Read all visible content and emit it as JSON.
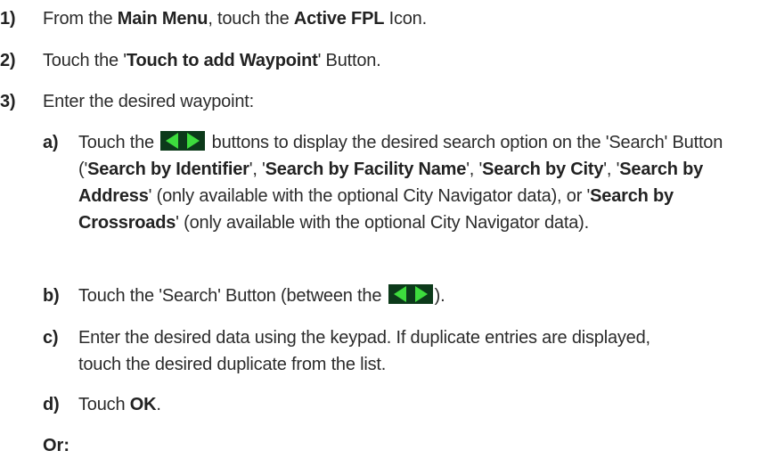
{
  "steps": [
    {
      "num": "1)",
      "parts": [
        {
          "t": "From the "
        },
        {
          "t": "Main Menu",
          "b": true
        },
        {
          "t": ", touch the "
        },
        {
          "t": "Active FPL",
          "b": true
        },
        {
          "t": " Icon."
        }
      ]
    },
    {
      "num": "2)",
      "parts": [
        {
          "t": "Touch the '"
        },
        {
          "t": "Touch to add Waypoint",
          "b": true
        },
        {
          "t": "' Button."
        }
      ]
    },
    {
      "num": "3)",
      "parts": [
        {
          "t": "Enter the desired waypoint:"
        }
      ]
    }
  ],
  "substeps": [
    {
      "num": "a)",
      "parts": [
        {
          "t": "Touch the "
        },
        {
          "icon": "arrow-buttons-icon"
        },
        {
          "t": " buttons to display the desired search option on the 'Search' Button ('"
        },
        {
          "t": "Search by Identifier",
          "b": true
        },
        {
          "t": "', '"
        },
        {
          "t": "Search by Facility Name",
          "b": true
        },
        {
          "t": "', '"
        },
        {
          "t": "Search by City",
          "b": true
        },
        {
          "t": "',  '"
        },
        {
          "t": "Search by Address",
          "b": true
        },
        {
          "t": "' (only available with the optional City Navigator data), or '"
        },
        {
          "t": "Search by Crossroads",
          "b": true
        },
        {
          "t": "' (only available with the optional City Navigator data)."
        }
      ]
    },
    {
      "num": "b)",
      "parts": [
        {
          "t": "Touch the 'Search' Button (between the "
        },
        {
          "icon": "arrow-buttons-icon"
        },
        {
          "t": ")."
        }
      ]
    },
    {
      "num": "c)",
      "parts": [
        {
          "t": "Enter the desired data using the keypad.  If duplicate entries are displayed, touch the desired duplicate from the list."
        }
      ]
    },
    {
      "num": "d)",
      "parts": [
        {
          "t": "Touch "
        },
        {
          "t": "OK",
          "b": true
        },
        {
          "t": "."
        }
      ]
    }
  ],
  "or_label": "Or:",
  "colors": {
    "arrow_bg": "#0c3a1a",
    "arrow_fg": "#3ddc3d"
  }
}
